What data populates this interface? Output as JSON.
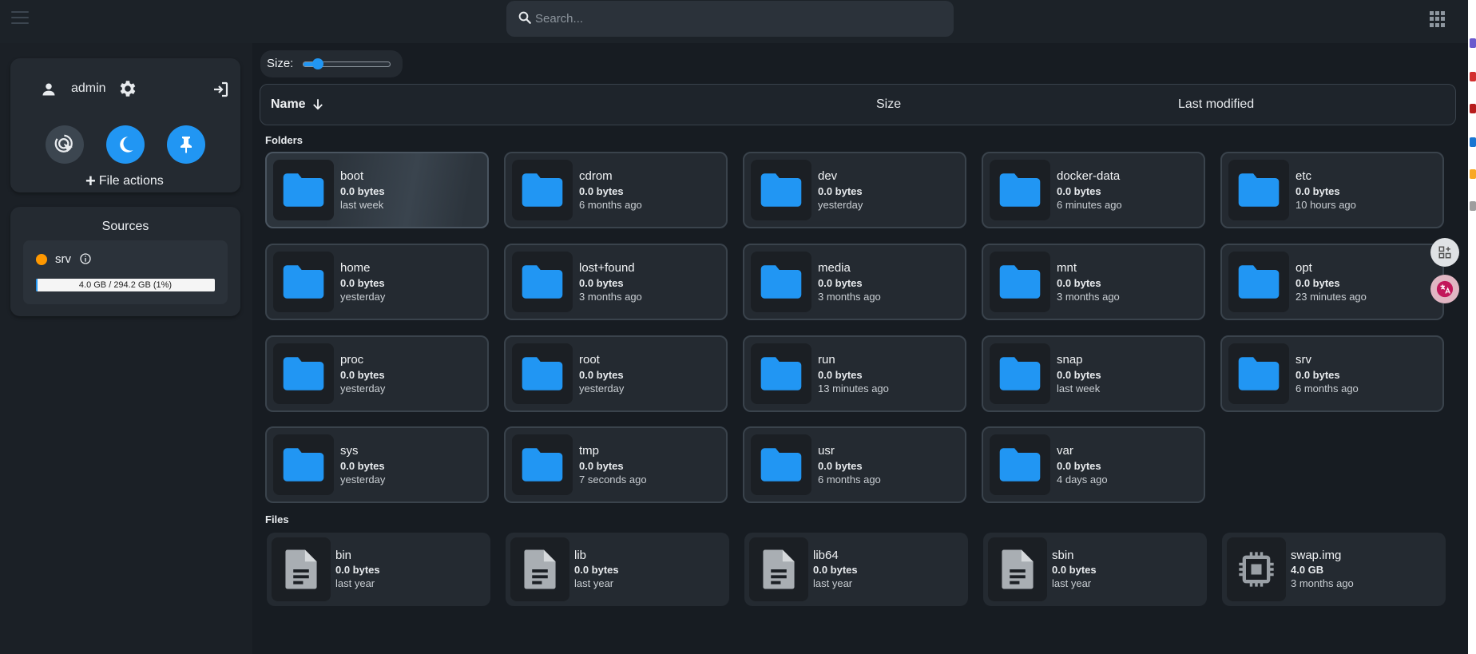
{
  "search": {
    "placeholder": "Search..."
  },
  "user": {
    "name": "admin"
  },
  "actions": {
    "file_actions_label": "File actions"
  },
  "sources": {
    "title": "Sources",
    "items": [
      {
        "name": "srv",
        "status_color": "#ff9800",
        "usage_text": "4.0 GB / 294.2 GB (1%)",
        "usage_fraction": 0.01
      }
    ]
  },
  "size_control": {
    "label": "Size:",
    "value_fraction": 0.17
  },
  "list_header": {
    "name": "Name",
    "size": "Size",
    "modified": "Last modified"
  },
  "sections": {
    "folders": "Folders",
    "files": "Files"
  },
  "folders": [
    {
      "name": "boot",
      "size": "0.0 bytes",
      "modified": "last week",
      "selected": true
    },
    {
      "name": "cdrom",
      "size": "0.0 bytes",
      "modified": "6 months ago"
    },
    {
      "name": "dev",
      "size": "0.0 bytes",
      "modified": "yesterday"
    },
    {
      "name": "docker-data",
      "size": "0.0 bytes",
      "modified": "6 minutes ago"
    },
    {
      "name": "etc",
      "size": "0.0 bytes",
      "modified": "10 hours ago"
    },
    {
      "name": "home",
      "size": "0.0 bytes",
      "modified": "yesterday"
    },
    {
      "name": "lost+found",
      "size": "0.0 bytes",
      "modified": "3 months ago"
    },
    {
      "name": "media",
      "size": "0.0 bytes",
      "modified": "3 months ago"
    },
    {
      "name": "mnt",
      "size": "0.0 bytes",
      "modified": "3 months ago"
    },
    {
      "name": "opt",
      "size": "0.0 bytes",
      "modified": "23 minutes ago"
    },
    {
      "name": "proc",
      "size": "0.0 bytes",
      "modified": "yesterday"
    },
    {
      "name": "root",
      "size": "0.0 bytes",
      "modified": "yesterday"
    },
    {
      "name": "run",
      "size": "0.0 bytes",
      "modified": "13 minutes ago"
    },
    {
      "name": "snap",
      "size": "0.0 bytes",
      "modified": "last week"
    },
    {
      "name": "srv",
      "size": "0.0 bytes",
      "modified": "6 months ago"
    },
    {
      "name": "sys",
      "size": "0.0 bytes",
      "modified": "yesterday"
    },
    {
      "name": "tmp",
      "size": "0.0 bytes",
      "modified": "7 seconds ago"
    },
    {
      "name": "usr",
      "size": "0.0 bytes",
      "modified": "6 months ago"
    },
    {
      "name": "var",
      "size": "0.0 bytes",
      "modified": "4 days ago"
    }
  ],
  "files": [
    {
      "name": "bin",
      "size": "0.0 bytes",
      "modified": "last year",
      "icon": "document-icon"
    },
    {
      "name": "lib",
      "size": "0.0 bytes",
      "modified": "last year",
      "icon": "document-icon"
    },
    {
      "name": "lib64",
      "size": "0.0 bytes",
      "modified": "last year",
      "icon": "document-icon"
    },
    {
      "name": "sbin",
      "size": "0.0 bytes",
      "modified": "last year",
      "icon": "document-icon"
    },
    {
      "name": "swap.img",
      "size": "4.0 GB",
      "modified": "3 months ago",
      "icon": "chip-icon"
    }
  ],
  "colors": {
    "accent": "#2196f3",
    "folder": "#2196f3",
    "source_status": "#ff9800"
  }
}
